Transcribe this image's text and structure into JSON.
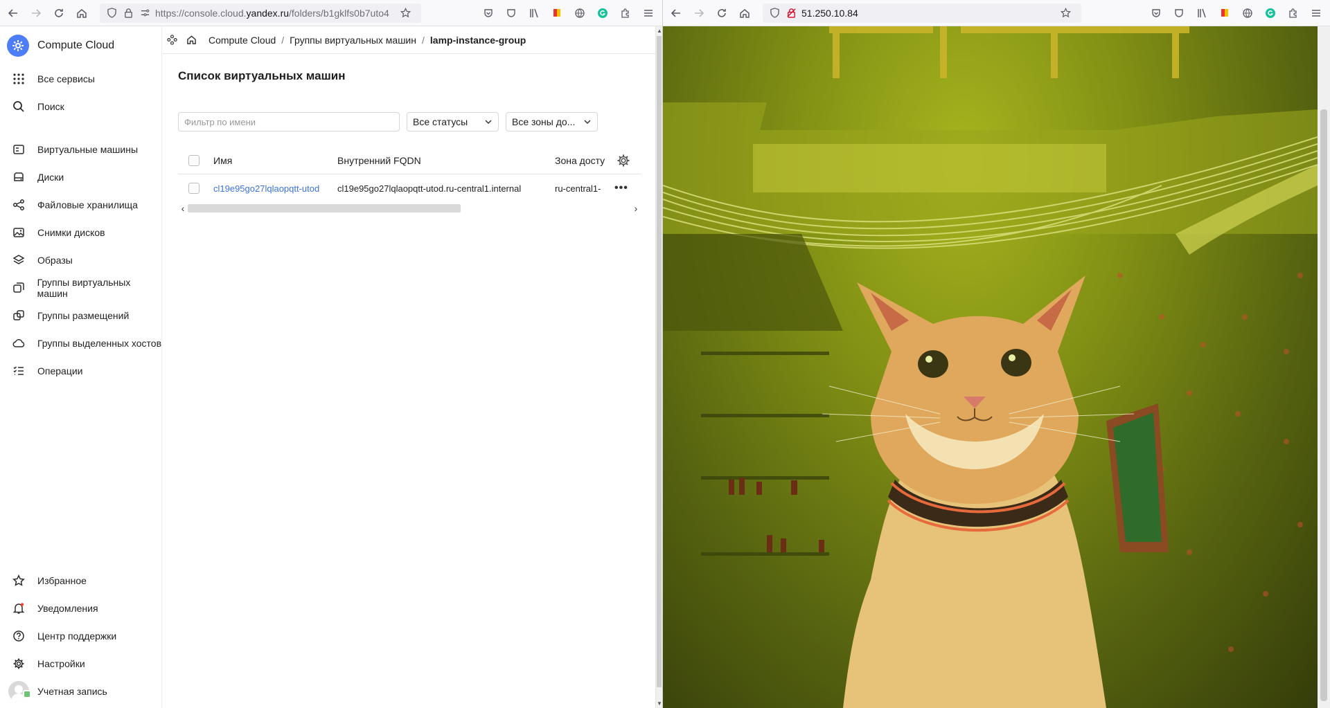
{
  "left_browser": {
    "url_prefix": "https://console.cloud.",
    "url_domain": "yandex.ru",
    "url_rest": "/folders/b1gklfs0b7uto4"
  },
  "right_browser": {
    "url": "51.250.10.84"
  },
  "sidebar": {
    "brand": "Compute Cloud",
    "top_items": [
      {
        "label": "Все сервисы",
        "icon": "grid-icon"
      },
      {
        "label": "Поиск",
        "icon": "search-icon"
      }
    ],
    "items": [
      {
        "label": "Виртуальные машины",
        "icon": "vm-icon"
      },
      {
        "label": "Диски",
        "icon": "disk-icon"
      },
      {
        "label": "Файловые хранилища",
        "icon": "share-icon"
      },
      {
        "label": "Снимки дисков",
        "icon": "image-icon"
      },
      {
        "label": "Образы",
        "icon": "layers-icon"
      },
      {
        "label": "Группы виртуальных машин",
        "icon": "group-icon"
      },
      {
        "label": "Группы размещений",
        "icon": "placement-icon"
      },
      {
        "label": "Группы выделенных хостов",
        "icon": "cloud-icon"
      },
      {
        "label": "Операции",
        "icon": "list-icon"
      }
    ],
    "bottom_items": [
      {
        "label": "Избранное",
        "icon": "star-icon"
      },
      {
        "label": "Уведомления",
        "icon": "bell-icon"
      },
      {
        "label": "Центр поддержки",
        "icon": "help-icon"
      },
      {
        "label": "Настройки",
        "icon": "gear-icon"
      },
      {
        "label": "Учетная запись",
        "icon": "avatar"
      }
    ]
  },
  "breadcrumbs": {
    "items": [
      "Compute Cloud",
      "Группы виртуальных машин"
    ],
    "current": "lamp-instance-group"
  },
  "page": {
    "title": "Список виртуальных машин",
    "filter_placeholder": "Фильтр по имени",
    "status_select": "Все статусы",
    "zone_select": "Все зоны до..."
  },
  "table": {
    "columns": [
      "Имя",
      "Внутренний FQDN",
      "Зона досту"
    ],
    "rows": [
      {
        "name": "cl19e95go27lqlaopqtt-utod",
        "fqdn": "cl19e95go27lqlaopqtt-utod.ru-central1.internal",
        "zone": "ru-central1-"
      }
    ]
  },
  "colors": {
    "accent": "#4e7ef7",
    "link": "#3b73dd"
  }
}
